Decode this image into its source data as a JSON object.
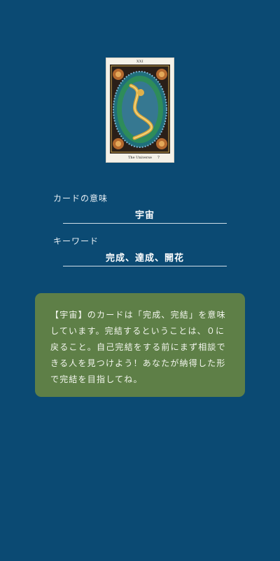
{
  "card": {
    "numeral": "XXI",
    "caption": "The Universe",
    "caption_number": "7",
    "icon": "tarot-card-universe"
  },
  "meaning": {
    "label": "カードの意味",
    "value": "宇宙"
  },
  "keyword": {
    "label": "キーワード",
    "value": "完成、達成、開花"
  },
  "description": {
    "text": "【宇宙】のカードは「完成、完結」を意味しています。完結するということは、０に戻ること。自己完結をする前にまず相談できる人を見つけよう！あなたが納得した形で完結を目指してね。"
  },
  "colors": {
    "background": "#0b4a73",
    "description_box": "#5e7f47"
  }
}
